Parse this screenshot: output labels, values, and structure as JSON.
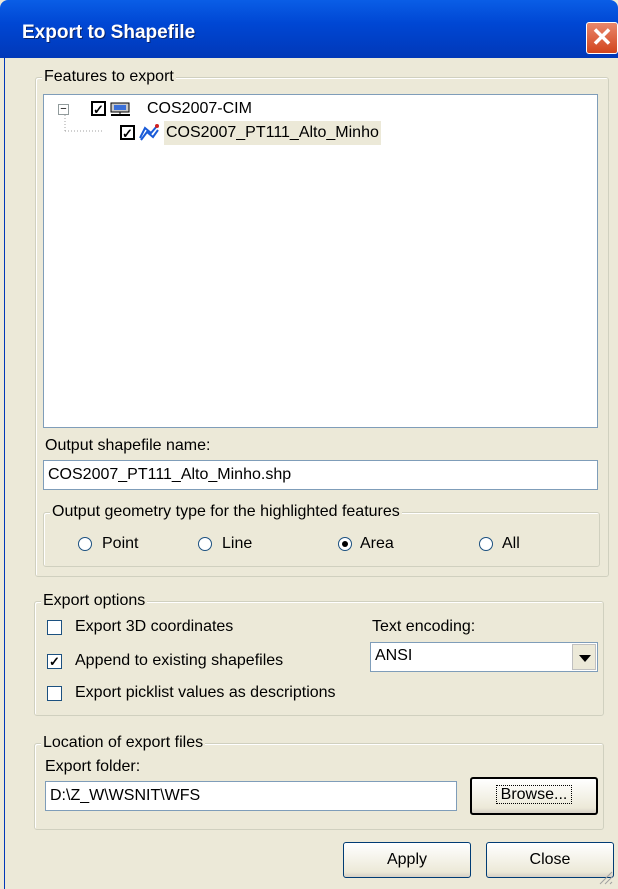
{
  "window": {
    "title": "Export to Shapefile"
  },
  "features": {
    "legend": "Features to export",
    "tree": [
      {
        "label": "COS2007-CIM",
        "checked": true,
        "icon": "server-icon"
      },
      {
        "label": "COS2007_PT111_Alto_Minho",
        "checked": true,
        "icon": "polygon-layer-icon"
      }
    ]
  },
  "output": {
    "name_label": "Output shapefile name:",
    "name_value": "COS2007_PT111_Alto_Minho.shp",
    "geometry_legend": "Output geometry type for the highlighted features",
    "geometry_options": [
      "Point",
      "Line",
      "Area",
      "All"
    ],
    "geometry_selected": "Area"
  },
  "export_options": {
    "legend": "Export options",
    "export_3d": {
      "label": "Export 3D coordinates",
      "checked": false
    },
    "append": {
      "label": "Append to existing shapefiles",
      "checked": true
    },
    "picklist": {
      "label": "Export picklist values as descriptions",
      "checked": false
    },
    "encoding_label": "Text encoding:",
    "encoding_value": "ANSI"
  },
  "location": {
    "legend": "Location of export files",
    "folder_label": "Export folder:",
    "folder_value": "D:\\Z_W\\WSNIT\\WFS",
    "browse_label": "Browse..."
  },
  "buttons": {
    "apply": "Apply",
    "close": "Close"
  },
  "colors": {
    "titlebar": "#0047d4",
    "dialog_bg": "#ece9d8",
    "close_button": "#d2441c"
  }
}
